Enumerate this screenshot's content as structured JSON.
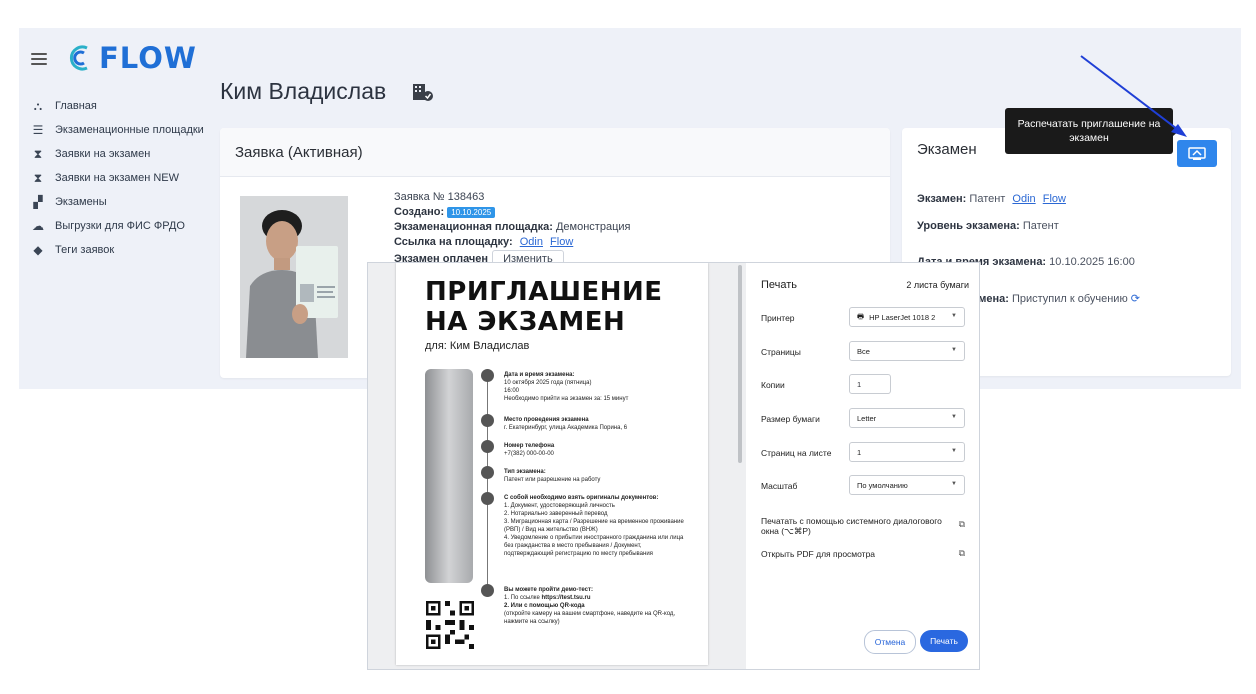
{
  "app": {
    "brand": "FLOW"
  },
  "sidebar": {
    "items": [
      {
        "label": "Главная",
        "icon": "network-icon"
      },
      {
        "label": "Экзаменационные площадки",
        "icon": "list-icon"
      },
      {
        "label": "Заявки на экзамен",
        "icon": "hourglass-icon"
      },
      {
        "label": "Заявки на экзамен NEW",
        "icon": "hourglass-icon"
      },
      {
        "label": "Экзамены",
        "icon": "podium-icon"
      },
      {
        "label": "Выгрузки для ФИС ФРДО",
        "icon": "cloud-upload-icon"
      },
      {
        "label": "Теги заявок",
        "icon": "tag-icon"
      }
    ]
  },
  "page": {
    "title": "Ким Владислав"
  },
  "application": {
    "header": "Заявка (Активная)",
    "number_label": "Заявка №",
    "number": "138463",
    "created_label": "Создано:",
    "created": "10.10.2025",
    "site_label": "Экзаменационная площадка:",
    "site": "Демонстрация",
    "link_label": "Ссылка на площадку:",
    "link1": "Odin",
    "link2": "Flow",
    "paid": "Экзамен оплачен",
    "edit_btn": "Изменить"
  },
  "exam": {
    "header": "Экзамен",
    "exam_label": "Экзамен:",
    "exam_value": "Патент",
    "link1": "Odin",
    "link2": "Flow",
    "level_label": "Уровень экзамена:",
    "level_value": "Патент",
    "date_label": "Дата и время экзамена:",
    "date_value": "10.10.2025 16:00",
    "status_label": "шения экзамена:",
    "status_value": "Приступил к обучению"
  },
  "tooltip": {
    "text": "Распечатать приглашение на экзамен"
  },
  "colors": {
    "accent": "#2f86ec",
    "brand": "#1f6fd6",
    "badge": "#2f95e8",
    "arrow": "#1f3fd6"
  },
  "print_dialog": {
    "title": "Печать",
    "sheets": "2 листа бумаги",
    "printer_label": "Принтер",
    "printer_value": "HP LaserJet 1018 2",
    "pages_label": "Страницы",
    "pages_value": "Все",
    "copies_label": "Копии",
    "copies_value": "1",
    "paper_label": "Размер бумаги",
    "paper_value": "Letter",
    "per_sheet_label": "Страниц на листе",
    "per_sheet_value": "1",
    "scale_label": "Масштаб",
    "scale_value": "По умолчанию",
    "system_dialog": "Печатать с помощью системного диалогового окна (⌥⌘P)",
    "open_pdf": "Открыть PDF для просмотра",
    "cancel": "Отмена",
    "print": "Печать"
  },
  "document": {
    "title_line1": "ПРИГЛАШЕНИЕ",
    "title_line2": "НА ЭКЗАМЕН",
    "for": "для: Ким Владислав",
    "datetime_head": "Дата и время экзамена:",
    "datetime_1": "10 октября 2025 года (пятница)",
    "datetime_2": "16:00",
    "datetime_3": "Необходимо прийти на экзамен за: 15 минут",
    "place_head": "Место проведения экзамена",
    "place": "г. Екатеринбург, улица Академика Порина, 6",
    "phone_head": "Номер телефона",
    "phone": "+7(382) 000-00-00",
    "type_head": "Тип экзамена:",
    "type": "Патент или разрешение на работу",
    "docs_head": "С собой необходимо взять оригиналы документов:",
    "docs_1": "1. Документ, удостоверяющий личность",
    "docs_2": "2. Нотариально заверенный перевод",
    "docs_3": "3. Миграционная карта / Разрешение на временное проживание (РВП) / Вид на жительство (ВНЖ)",
    "docs_4": "4. Уведомление о прибытии иностранного гражданина или лица без гражданства в место пребывания / Документ, подтверждающий регистрацию по месту пребывания",
    "demo_head": "Вы можете пройти демо-тест:",
    "demo_1": "1. По ссылке",
    "demo_link": "https://test.tsu.ru",
    "demo_2": "2. Или с помощью QR-кода",
    "demo_2_note": "(откройте камеру на вашем смартфоне, наведите на QR-код, нажмите на ссылку)"
  }
}
